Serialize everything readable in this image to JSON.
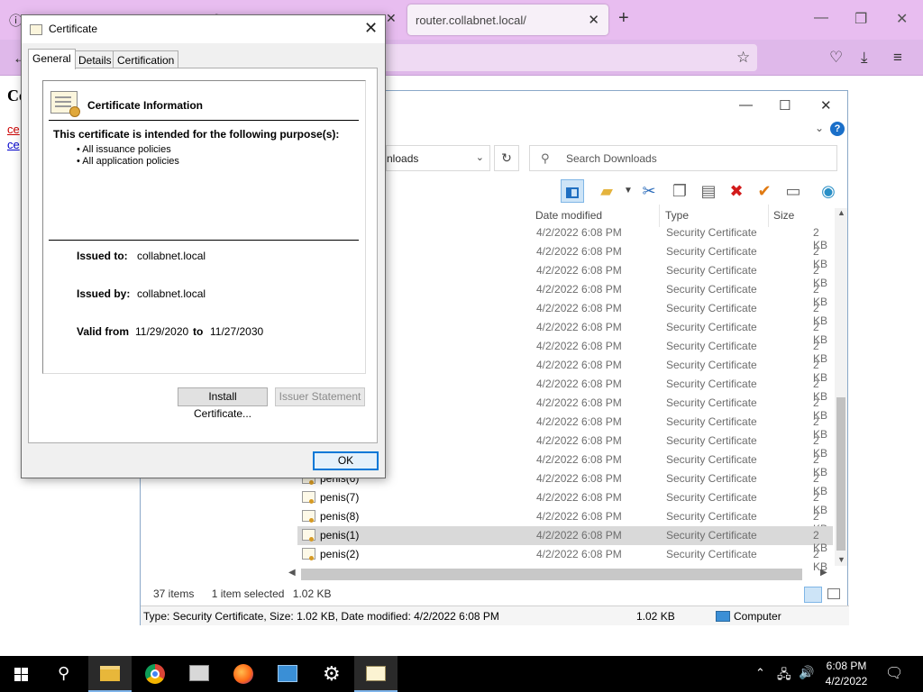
{
  "browser": {
    "tab_title": "router.collabnet.local/",
    "page_heading_fragment": "Ce",
    "page_links": [
      "ce",
      "ce"
    ]
  },
  "explorer": {
    "address_fragment": "nloads",
    "search_placeholder": "Search Downloads",
    "columns": [
      "Date modified",
      "Type",
      "Size"
    ],
    "rows": [
      {
        "name": "",
        "date": "4/2/2022 6:08 PM",
        "type": "Security Certificate",
        "size": "2 KB"
      },
      {
        "name": "",
        "date": "4/2/2022 6:08 PM",
        "type": "Security Certificate",
        "size": "2 KB"
      },
      {
        "name": "",
        "date": "4/2/2022 6:08 PM",
        "type": "Security Certificate",
        "size": "2 KB"
      },
      {
        "name": "",
        "date": "4/2/2022 6:08 PM",
        "type": "Security Certificate",
        "size": "2 KB"
      },
      {
        "name": "",
        "date": "4/2/2022 6:08 PM",
        "type": "Security Certificate",
        "size": "2 KB"
      },
      {
        "name": "",
        "date": "4/2/2022 6:08 PM",
        "type": "Security Certificate",
        "size": "2 KB"
      },
      {
        "name": "",
        "date": "4/2/2022 6:08 PM",
        "type": "Security Certificate",
        "size": "2 KB"
      },
      {
        "name": "",
        "date": "4/2/2022 6:08 PM",
        "type": "Security Certificate",
        "size": "2 KB"
      },
      {
        "name": "",
        "date": "4/2/2022 6:08 PM",
        "type": "Security Certificate",
        "size": "2 KB"
      },
      {
        "name": "",
        "date": "4/2/2022 6:08 PM",
        "type": "Security Certificate",
        "size": "2 KB"
      },
      {
        "name": "",
        "date": "4/2/2022 6:08 PM",
        "type": "Security Certificate",
        "size": "2 KB"
      },
      {
        "name": "",
        "date": "4/2/2022 6:08 PM",
        "type": "Security Certificate",
        "size": "2 KB"
      },
      {
        "name": "",
        "date": "4/2/2022 6:08 PM",
        "type": "Security Certificate",
        "size": "2 KB"
      },
      {
        "name": "penis(6)",
        "date": "4/2/2022 6:08 PM",
        "type": "Security Certificate",
        "size": "2 KB"
      },
      {
        "name": "penis(7)",
        "date": "4/2/2022 6:08 PM",
        "type": "Security Certificate",
        "size": "2 KB"
      },
      {
        "name": "penis(8)",
        "date": "4/2/2022 6:08 PM",
        "type": "Security Certificate",
        "size": "2 KB"
      },
      {
        "name": "penis(1)",
        "date": "4/2/2022 6:08 PM",
        "type": "Security Certificate",
        "size": "2 KB",
        "selected": true
      },
      {
        "name": "penis(2)",
        "date": "4/2/2022 6:08 PM",
        "type": "Security Certificate",
        "size": "2 KB"
      }
    ],
    "item_count": "37 items",
    "selected_count": "1 item selected",
    "selected_size": "1.02 KB",
    "details": "Type: Security Certificate, Size: 1.02 KB, Date modified: 4/2/2022 6:08 PM",
    "status_size": "1.02 KB",
    "status_location": "Computer"
  },
  "certificate": {
    "window_title": "Certificate",
    "tabs": [
      "General",
      "Details",
      "Certification Path"
    ],
    "info_title": "Certificate Information",
    "purpose_heading": "This certificate is intended for the following purpose(s):",
    "purposes": [
      "• All issuance policies",
      "• All application policies"
    ],
    "issued_to_label": "Issued to:",
    "issued_to": "collabnet.local",
    "issued_by_label": "Issued by:",
    "issued_by": "collabnet.local",
    "valid_from_label": "Valid from",
    "valid_from": "11/29/2020",
    "valid_to_label": "to",
    "valid_to": "11/27/2030",
    "install_button": "Install Certificate...",
    "issuer_button": "Issuer Statement",
    "ok_button": "OK"
  },
  "taskbar": {
    "time": "6:08 PM",
    "date": "4/2/2022"
  },
  "colors": {
    "firefox_tabbar": "#e8bdf0",
    "selection": "#d9d9d9",
    "accent": "#0078d7"
  }
}
